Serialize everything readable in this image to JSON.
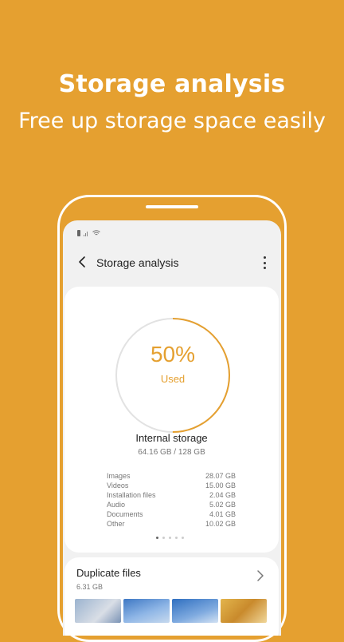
{
  "promo": {
    "headline": "Storage analysis",
    "subline": "Free up storage space easily"
  },
  "app_bar": {
    "title": "Storage analysis"
  },
  "storage_card": {
    "percent_label": "50%",
    "percent_value": 0.5,
    "used_label": "Used",
    "storage_title": "Internal storage",
    "storage_usage": "64.16 GB / 128 GB",
    "breakdown": [
      {
        "label": "Images",
        "value": "28.07 GB"
      },
      {
        "label": "Videos",
        "value": "15.00 GB"
      },
      {
        "label": "Installation files",
        "value": "2.04 GB"
      },
      {
        "label": "Audio",
        "value": "5.02 GB"
      },
      {
        "label": "Documents",
        "value": "4.01 GB"
      },
      {
        "label": "Other",
        "value": "10.02 GB"
      }
    ],
    "page_indicator": {
      "count": 5,
      "active": 1
    }
  },
  "duplicate_card": {
    "title": "Duplicate files",
    "size": "6.31 GB"
  },
  "colors": {
    "accent": "#E5A030",
    "ring_track": "#E2E2E2",
    "screen_bg": "#F1F1F1"
  }
}
